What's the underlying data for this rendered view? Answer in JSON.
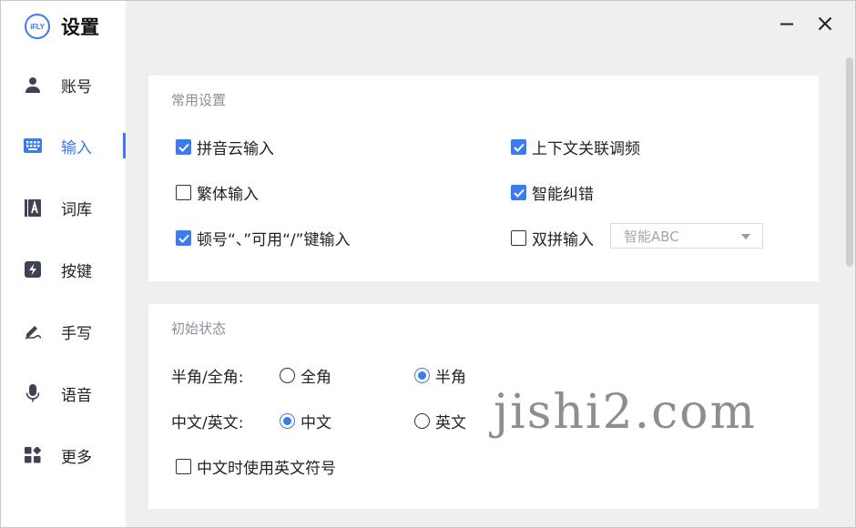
{
  "app": {
    "logo_text": "iFLY",
    "title": "设置"
  },
  "window_controls": {
    "minimize_icon": "minus-icon",
    "close_icon": "close-icon"
  },
  "sidebar": {
    "items": [
      {
        "id": "account",
        "label": "账号",
        "icon": "person-icon"
      },
      {
        "id": "input",
        "label": "输入",
        "icon": "keyboard-icon",
        "active": true
      },
      {
        "id": "lexicon",
        "label": "词库",
        "icon": "book-icon"
      },
      {
        "id": "keys",
        "label": "按键",
        "icon": "lightning-icon"
      },
      {
        "id": "handwrite",
        "label": "手写",
        "icon": "pen-icon"
      },
      {
        "id": "voice",
        "label": "语音",
        "icon": "microphone-icon"
      },
      {
        "id": "more",
        "label": "更多",
        "icon": "apps-icon"
      }
    ]
  },
  "common_settings": {
    "title": "常用设置",
    "options": [
      {
        "label": "拼音云输入",
        "checked": true
      },
      {
        "label": "上下文关联调频",
        "checked": true
      },
      {
        "label": "繁体输入",
        "checked": false
      },
      {
        "label": "智能纠错",
        "checked": true
      },
      {
        "label": "顿号“、”可用“/”键输入",
        "checked": true
      },
      {
        "label": "双拼输入",
        "checked": false
      }
    ],
    "shuangpin_scheme": "智能ABC"
  },
  "initial_state": {
    "title": "初始状态",
    "width_label": "半角/全角:",
    "width_options": [
      {
        "label": "全角",
        "selected": false
      },
      {
        "label": "半角",
        "selected": true
      }
    ],
    "lang_label": "中文/英文:",
    "lang_options": [
      {
        "label": "中文",
        "selected": true
      },
      {
        "label": "英文",
        "selected": false
      }
    ],
    "en_punct": {
      "label": "中文时使用英文符号",
      "checked": false
    }
  },
  "watermark": "jishi2.com",
  "colors": {
    "accent": "#3b7bf0",
    "background": "#efefef",
    "card": "#ffffff"
  }
}
